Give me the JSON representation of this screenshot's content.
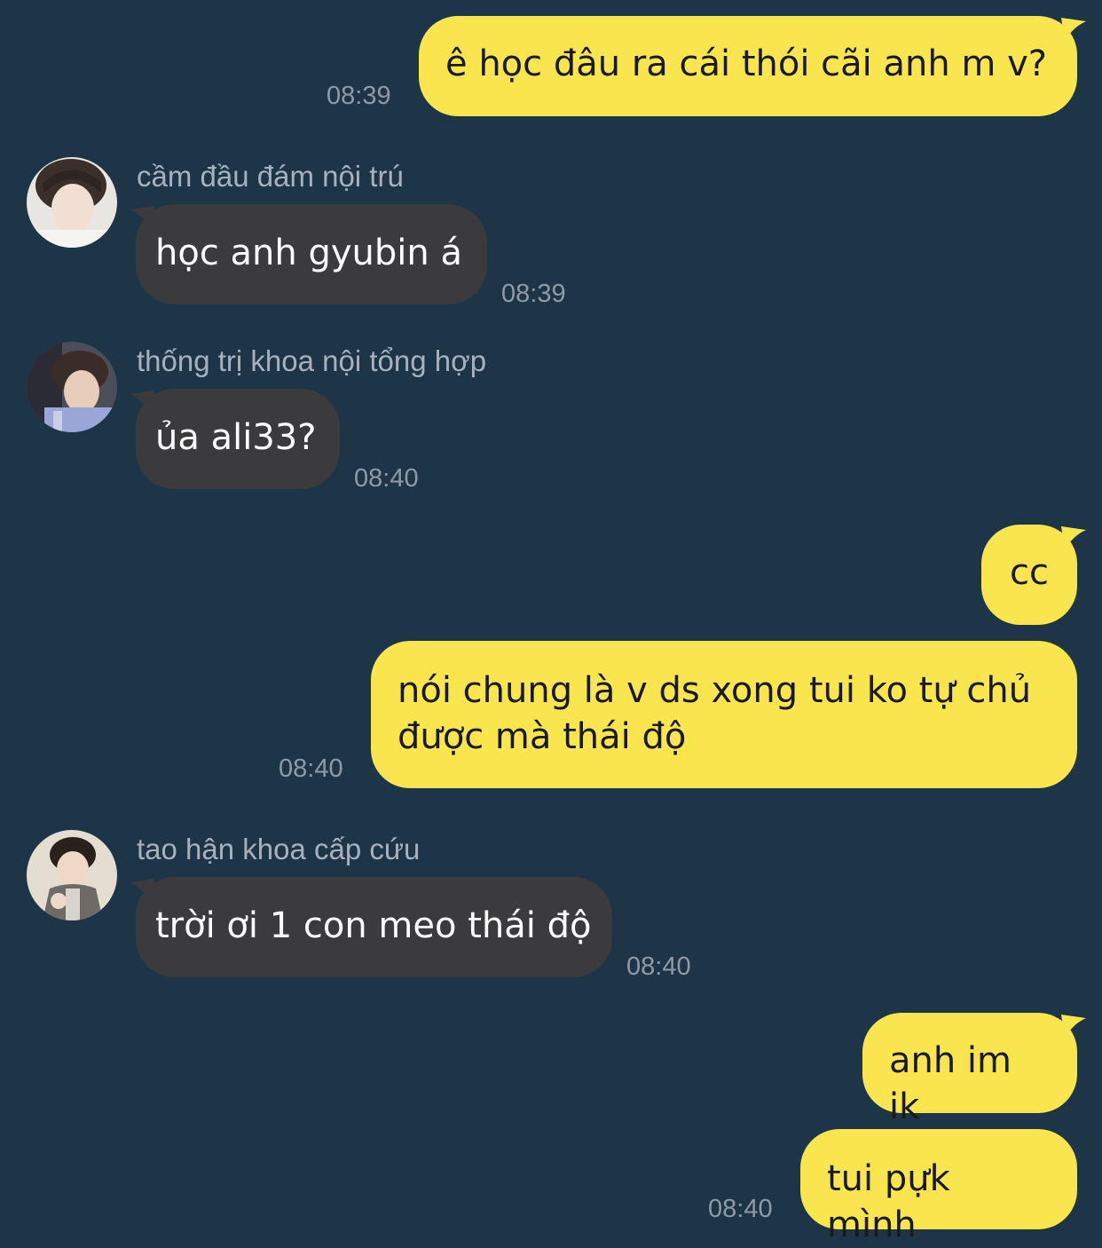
{
  "colors": {
    "background": "#1e3548",
    "outgoing_bubble": "#f9e64f",
    "incoming_bubble": "#3b3b3d",
    "timestamp": "#8f9aa6",
    "sender_name": "#a6b1bd"
  },
  "messages": [
    {
      "direction": "out",
      "text": "ê học đâu ra cái thói cãi anh m v?",
      "time": "08:39"
    },
    {
      "direction": "in",
      "sender": "cầm đầu đám nội trú",
      "avatar": "avatar-photo-1",
      "text": "học anh gyubin á",
      "time": "08:39"
    },
    {
      "direction": "in",
      "sender": "thống trị khoa nội tổng hợp",
      "avatar": "avatar-photo-2",
      "text": "ủa ali33?",
      "time": "08:40"
    },
    {
      "direction": "out",
      "text": "cc"
    },
    {
      "direction": "out",
      "text": "nói chung là v ds xong tui ko tự chủ\nđược mà thái độ",
      "time": "08:40"
    },
    {
      "direction": "in",
      "sender": "tao hận khoa cấp cứu",
      "avatar": "avatar-photo-3",
      "text": "trời ơi 1 con meo thái độ",
      "time": "08:40"
    },
    {
      "direction": "out",
      "text": "anh im ik"
    },
    {
      "direction": "out",
      "text": "tui pựk mình",
      "time": "08:40"
    }
  ]
}
